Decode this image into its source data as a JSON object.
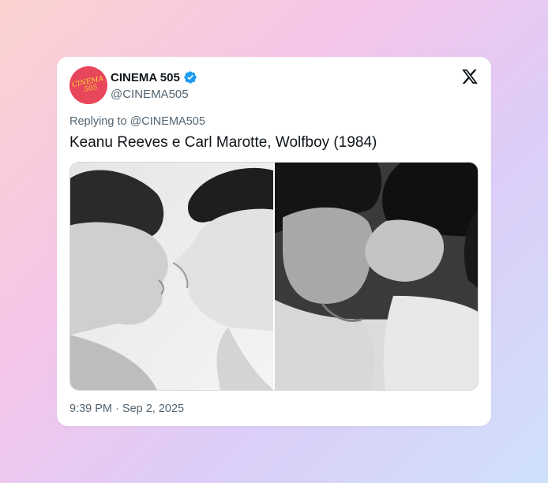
{
  "tweet": {
    "author": {
      "display_name": "CINEMA 505",
      "handle": "@CINEMA505",
      "verified": true,
      "avatar_text": "CINEMA 505",
      "avatar_color": "#e8465a"
    },
    "replying_to_prefix": "Replying to",
    "replying_to_handle": "@CINEMA505",
    "text": "Keanu Reeves e Carl Marotte, Wolfboy (1984)",
    "media": [
      {
        "alt": "black-and-white photo of two young men facing each other"
      },
      {
        "alt": "black-and-white photo of two young men kissing"
      }
    ],
    "time": "9:39 PM",
    "separator": "·",
    "date": "Sep 2, 2025"
  },
  "icons": {
    "platform_logo": "x-logo-icon",
    "verified": "verified-badge-icon"
  },
  "colors": {
    "verified_blue": "#1d9bf0",
    "text_primary": "#0f1419",
    "text_secondary": "#536471"
  }
}
